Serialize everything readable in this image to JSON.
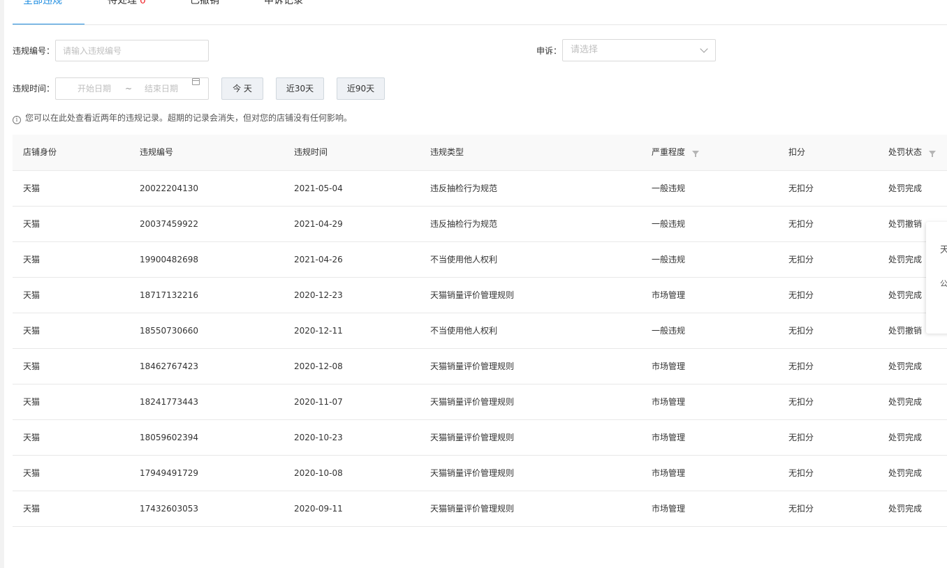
{
  "tabs": [
    {
      "label": "全部违规",
      "active": true
    },
    {
      "label": "待处理",
      "count": "0"
    },
    {
      "label": "已撤销"
    },
    {
      "label": "申诉记录"
    }
  ],
  "filters": {
    "violation_no_label": "违规编号：",
    "violation_no_placeholder": "请输入违规编号",
    "appeal_label": "申诉：",
    "appeal_placeholder": "请选择",
    "time_label": "违规时间：",
    "start_placeholder": "开始日期",
    "range_sep": "~",
    "end_placeholder": "结束日期",
    "btn_today": "今 天",
    "btn_30": "近30天",
    "btn_90": "近90天"
  },
  "notice": "您可以在此处查看近两年的违规记录。超期的记录会消失，但对您的店铺没有任何影响。",
  "table": {
    "headers": [
      "店铺身份",
      "违规编号",
      "违规时间",
      "违规类型",
      "严重程度",
      "扣分",
      "处罚状态"
    ],
    "rows": [
      [
        "天猫",
        "20022204130",
        "2021-05-04",
        "违反抽检行为规范",
        "一般违规",
        "无扣分",
        "处罚完成"
      ],
      [
        "天猫",
        "20037459922",
        "2021-04-29",
        "违反抽检行为规范",
        "一般违规",
        "无扣分",
        "处罚撤销"
      ],
      [
        "天猫",
        "19900482698",
        "2021-04-26",
        "不当使用他人权利",
        "一般违规",
        "无扣分",
        "处罚完成"
      ],
      [
        "天猫",
        "18717132216",
        "2020-12-23",
        "天猫销量评价管理规则",
        "市场管理",
        "无扣分",
        "处罚完成"
      ],
      [
        "天猫",
        "18550730660",
        "2020-12-11",
        "不当使用他人权利",
        "一般违规",
        "无扣分",
        "处罚撤销"
      ],
      [
        "天猫",
        "18462767423",
        "2020-12-08",
        "天猫销量评价管理规则",
        "市场管理",
        "无扣分",
        "处罚完成"
      ],
      [
        "天猫",
        "18241773443",
        "2020-11-07",
        "天猫销量评价管理规则",
        "市场管理",
        "无扣分",
        "处罚完成"
      ],
      [
        "天猫",
        "18059602394",
        "2020-10-23",
        "天猫销量评价管理规则",
        "市场管理",
        "无扣分",
        "处罚完成"
      ],
      [
        "天猫",
        "17949491729",
        "2020-10-08",
        "天猫销量评价管理规则",
        "市场管理",
        "无扣分",
        "处罚完成"
      ],
      [
        "天猫",
        "17432603053",
        "2020-09-11",
        "天猫销量评价管理规则",
        "市场管理",
        "无扣分",
        "处罚完成"
      ]
    ]
  },
  "float_panel": {
    "line1": "天",
    "line2": "公"
  },
  "colors": {
    "accent": "#1d8ce0",
    "count_red": "#f0282d"
  }
}
